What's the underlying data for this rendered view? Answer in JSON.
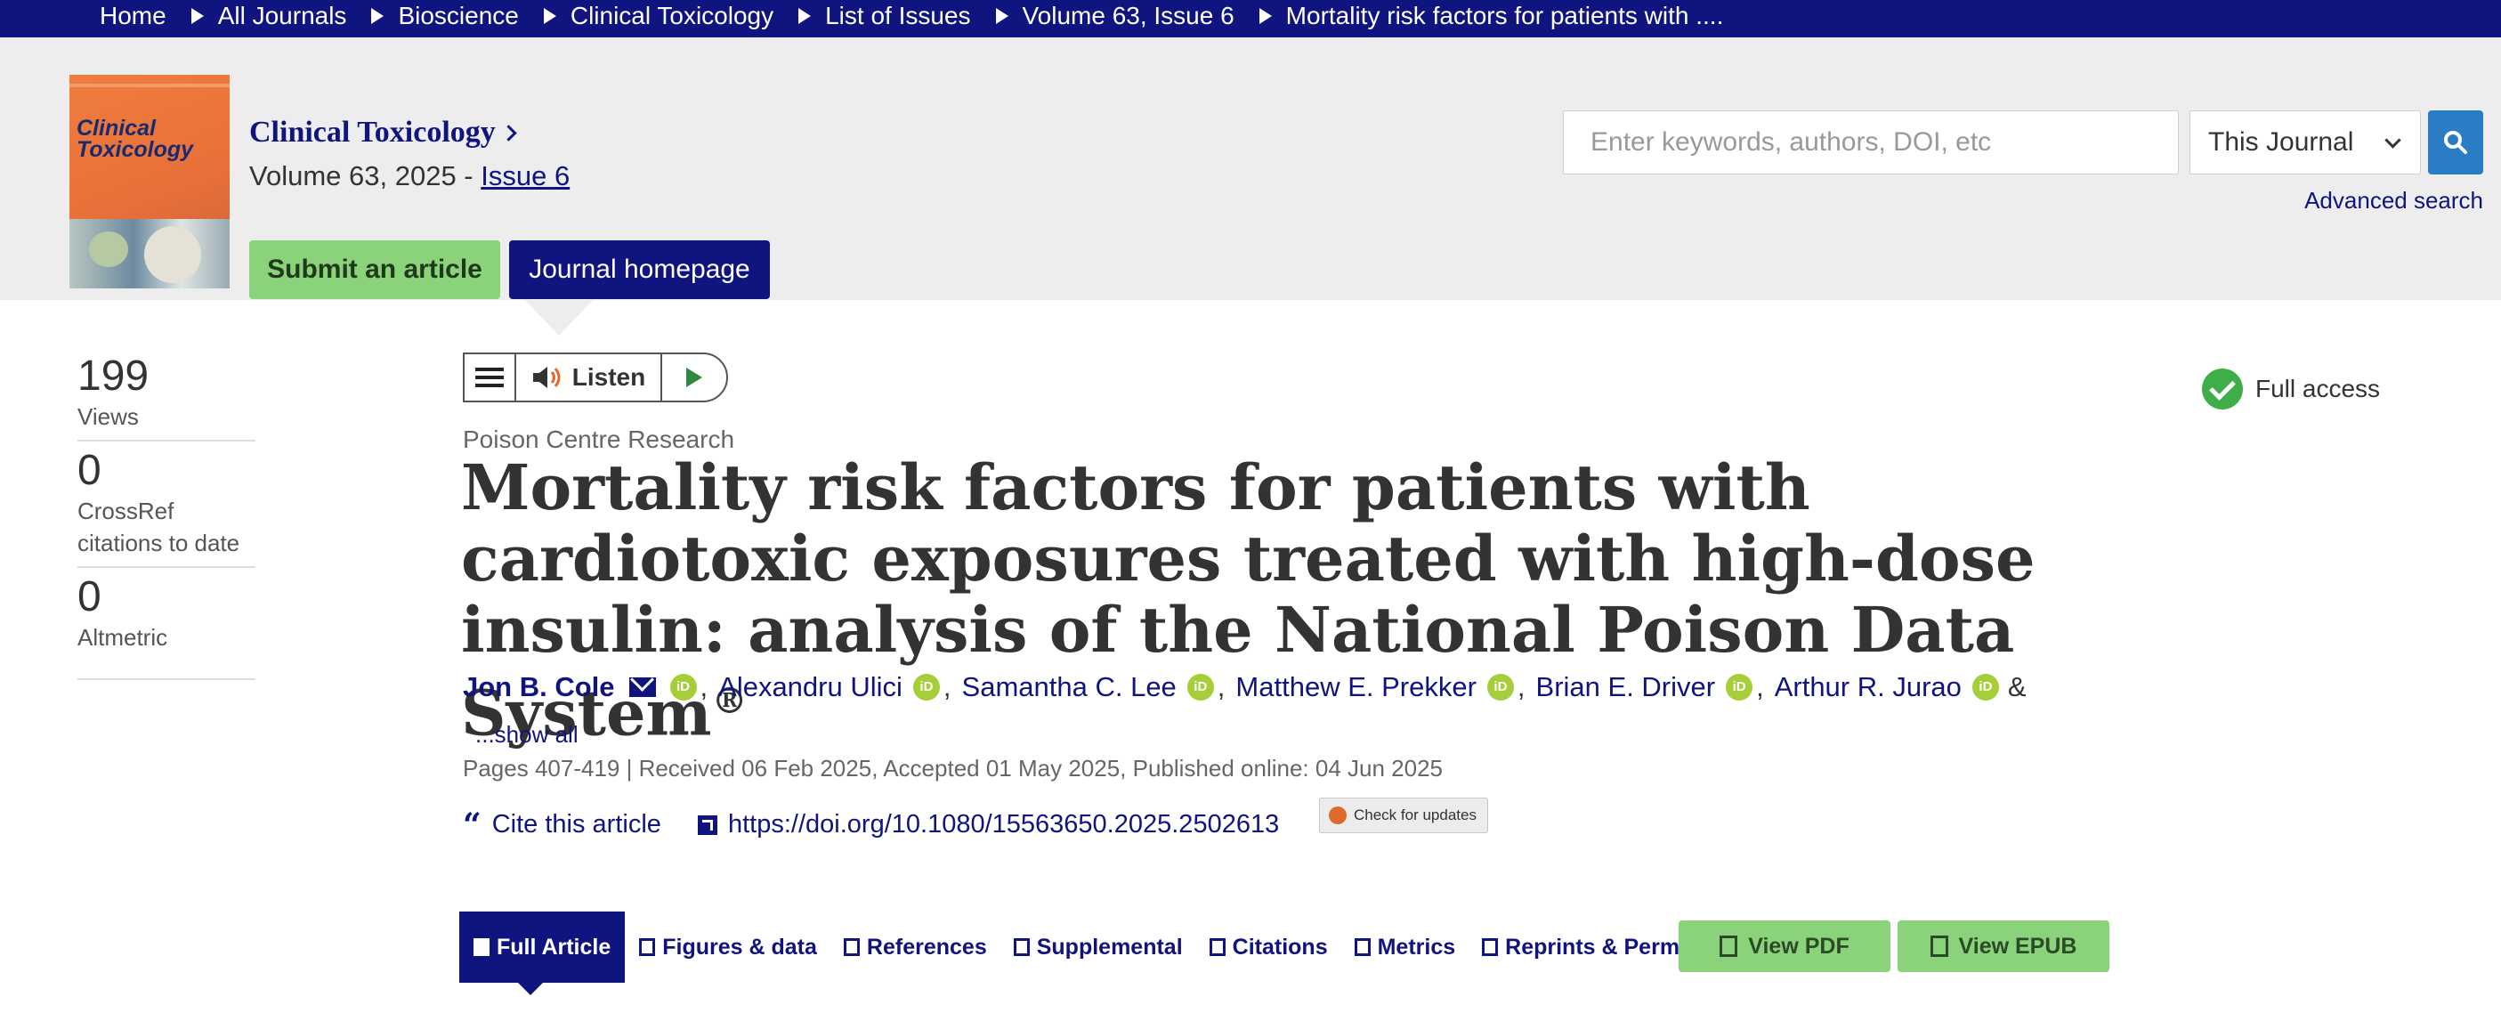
{
  "breadcrumb": {
    "items": [
      "Home",
      "All Journals",
      "Bioscience",
      "Clinical Toxicology",
      "List of Issues",
      "Volume 63, Issue 6",
      "Mortality risk factors for patients with ...."
    ]
  },
  "journal": {
    "cover_title": "Clinical Toxicology",
    "name": "Clinical Toxicology",
    "volume_text": "Volume 63, 2025 -",
    "issue_link": "Issue 6",
    "submit_label": "Submit an article",
    "homepage_label": "Journal homepage"
  },
  "search": {
    "placeholder": "Enter keywords, authors, DOI, etc",
    "scope": "This Journal",
    "advanced_label": "Advanced search"
  },
  "metrics": [
    {
      "value": "199",
      "label": "Views"
    },
    {
      "value": "0",
      "label": "CrossRef citations to date"
    },
    {
      "value": "0",
      "label": "Altmetric"
    }
  ],
  "listen": {
    "label": "Listen"
  },
  "access": {
    "label": "Full access"
  },
  "article": {
    "section": "Poison Centre Research",
    "title": "Mortality risk factors for patients with cardiotoxic exposures treated with high-dose insulin: analysis of the National Poison Data System",
    "title_mark": "®",
    "authors": [
      "Jon B. Cole",
      "Alexandru Ulici",
      "Samantha C. Lee",
      "Matthew E. Prekker",
      "Brian E. Driver",
      "Arthur R. Jurao"
    ],
    "authors_more": "&",
    "show_all": "...show all",
    "pub_info": "Pages 407-419 | Received 06 Feb 2025, Accepted 01 May 2025, Published online: 04 Jun 2025",
    "cite_label": "Cite this article",
    "doi": "https://doi.org/10.1080/15563650.2025.2502613",
    "updates_label": "Check for updates"
  },
  "tabs": [
    "Full Article",
    "Figures & data",
    "References",
    "Supplemental",
    "Citations",
    "Metrics",
    "Reprints & Permissions"
  ],
  "actions": {
    "pdf": "View PDF",
    "epub": "View EPUB"
  },
  "colors": {
    "navy": "#10147e",
    "green": "#8bd37a",
    "orcid": "#a6ce39",
    "access": "#3fae49"
  }
}
